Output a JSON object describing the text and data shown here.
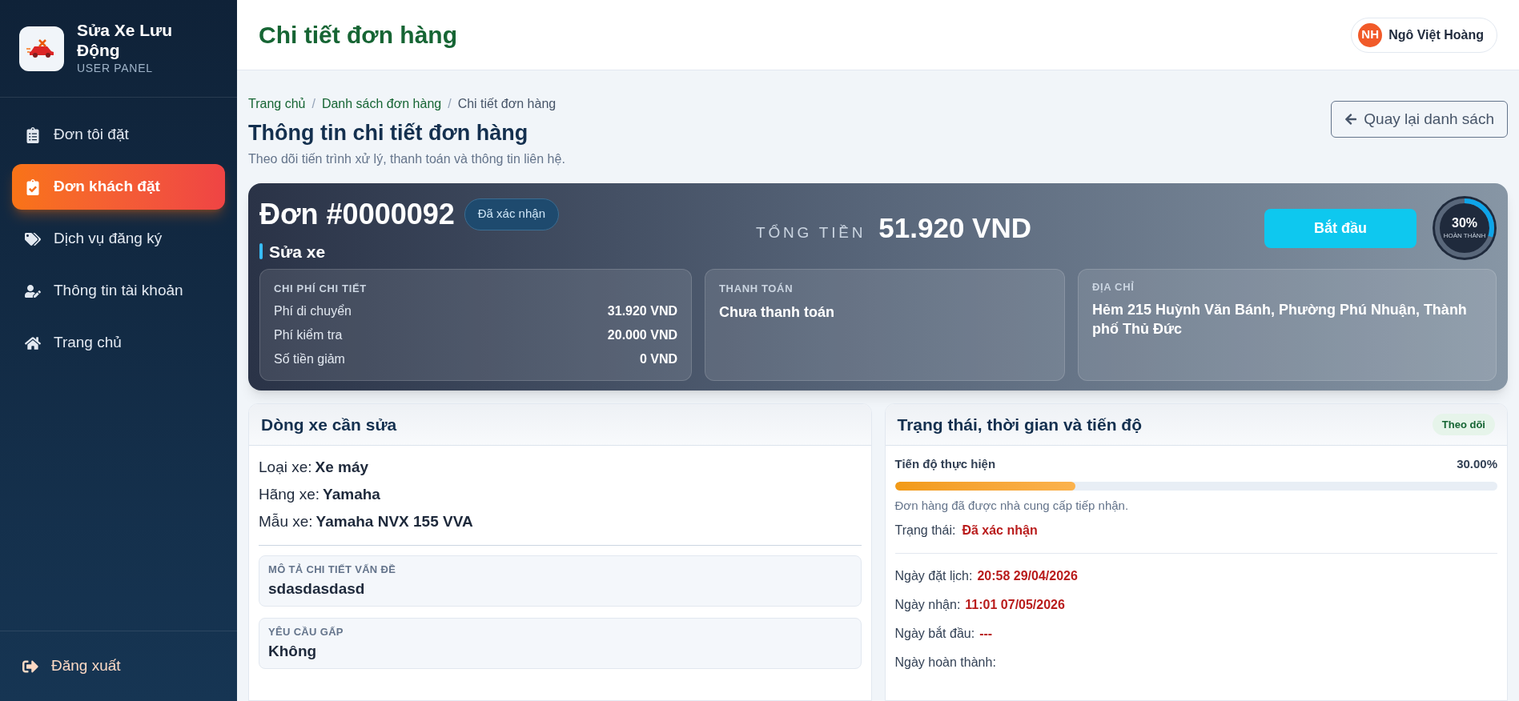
{
  "sidebar": {
    "brand": {
      "title": "Sửa Xe Lưu Động",
      "subtitle": "USER PANEL"
    },
    "items": [
      {
        "label": "Đơn tôi đặt",
        "selected": false
      },
      {
        "label": "Đơn khách đặt",
        "selected": true
      },
      {
        "label": "Dịch vụ đăng ký",
        "selected": false
      },
      {
        "label": "Thông tin tài khoản",
        "selected": false
      },
      {
        "label": "Trang chủ",
        "selected": false
      }
    ],
    "logout": "Đăng xuất"
  },
  "header": {
    "title": "Chi tiết đơn hàng",
    "user": {
      "initials": "NH",
      "name": "Ngô Việt Hoàng"
    }
  },
  "breadcrumb": [
    {
      "label": "Trang chủ",
      "kind": "link"
    },
    {
      "label": "/",
      "kind": "separator"
    },
    {
      "label": "Danh sách đơn hàng",
      "kind": "link"
    },
    {
      "label": "/",
      "kind": "separator"
    },
    {
      "label": "Chi tiết đơn hàng",
      "kind": "current"
    }
  ],
  "page": {
    "title": "Thông tin chi tiết đơn hàng",
    "subtitle": "Theo dõi tiến trình xử lý, thanh toán và thông tin liên hệ.",
    "back_button": "Quay lại danh sách"
  },
  "order": {
    "number": "Đơn #0000092",
    "status": "Đã xác nhận",
    "total_label": "TỔNG TIỀN",
    "total": "51.920 VND",
    "service": "Sửa xe",
    "action": "Bắt đầu",
    "progress": {
      "level": 0.3,
      "percent": "30%",
      "caption": "HOÀN THÀNH"
    },
    "costs": {
      "title": "CHI PHÍ CHI TIẾT",
      "rows": [
        {
          "label": "Phí di chuyển",
          "value": "31.920 VND"
        },
        {
          "label": "Phí kiểm tra",
          "value": "20.000 VND"
        },
        {
          "label": "Số tiền giảm",
          "value": "0 VND"
        }
      ]
    },
    "payment": {
      "title": "THANH TOÁN",
      "value": "Chưa thanh toán"
    },
    "address": {
      "title": "ĐỊA CHỈ",
      "value": "Hẻm 215 Huỳnh Văn Bánh, Phường Phú Nhuận, Thành phố Thủ Đức"
    }
  },
  "vehicle": {
    "title": "Dòng xe cần sửa",
    "fields": [
      {
        "label": "Loại xe:",
        "value": "Xe máy"
      },
      {
        "label": "Hãng xe:",
        "value": "Yamaha"
      },
      {
        "label": "Mẫu xe:",
        "value": "Yamaha NVX 155 VVA"
      }
    ],
    "boxes": [
      {
        "label": "MÔ TẢ CHI TIẾT VẤN ĐỀ",
        "value": "sdasdasdasd"
      },
      {
        "label": "YÊU CẦU GẤP",
        "value": "Không"
      }
    ]
  },
  "status_panel": {
    "title": "Trạng thái, thời gian và tiến độ",
    "badge": "Theo dõi",
    "progress": {
      "label": "Tiến độ thực hiện",
      "reading": "30.00%",
      "level": 0.3
    },
    "note": "Đơn hàng đã được nhà cung cấp tiếp nhận.",
    "status": {
      "label": "Trạng thái:",
      "value": "Đã xác nhận"
    },
    "dates": [
      {
        "label": "Ngày đặt lịch:",
        "value": "20:58 29/04/2026"
      },
      {
        "label": "Ngày nhận:",
        "value": "11:01 07/05/2026"
      },
      {
        "label": "Ngày bắt đầu:",
        "value": "---"
      }
    ],
    "pending_label": "Ngày hoàn thành:"
  }
}
